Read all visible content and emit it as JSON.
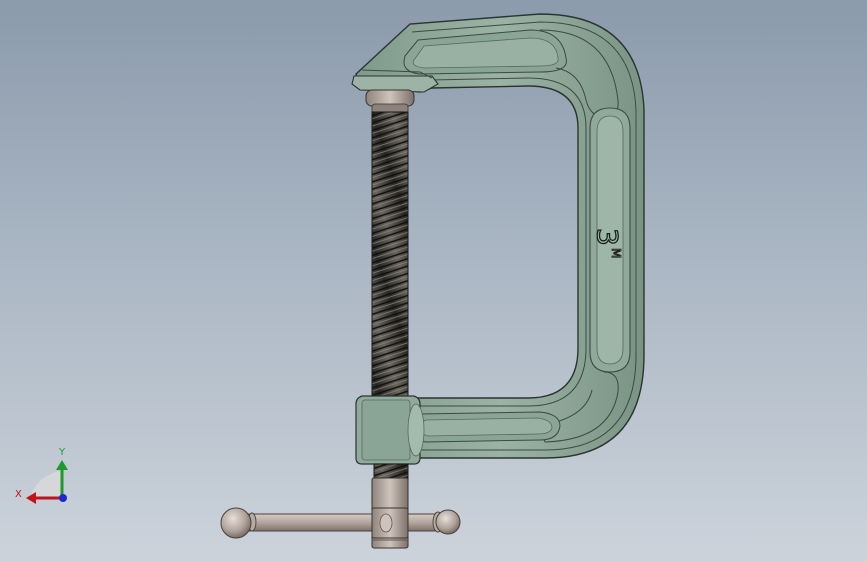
{
  "model": {
    "marking_numeral": "3",
    "marking_letter": "M"
  },
  "triad": {
    "x_label": "X",
    "y_label": "Y",
    "colors": {
      "x_axis": "#c0141a",
      "y_axis": "#1e9a2a",
      "z_axis": "#1a2ad0"
    }
  },
  "colors": {
    "frame": "#88a294",
    "frame_dark": "#56685c",
    "frame_light": "#a9c0b3",
    "screw": "#3a3a34",
    "steel": "#b9aca3",
    "steel_dark": "#7a6e68"
  }
}
